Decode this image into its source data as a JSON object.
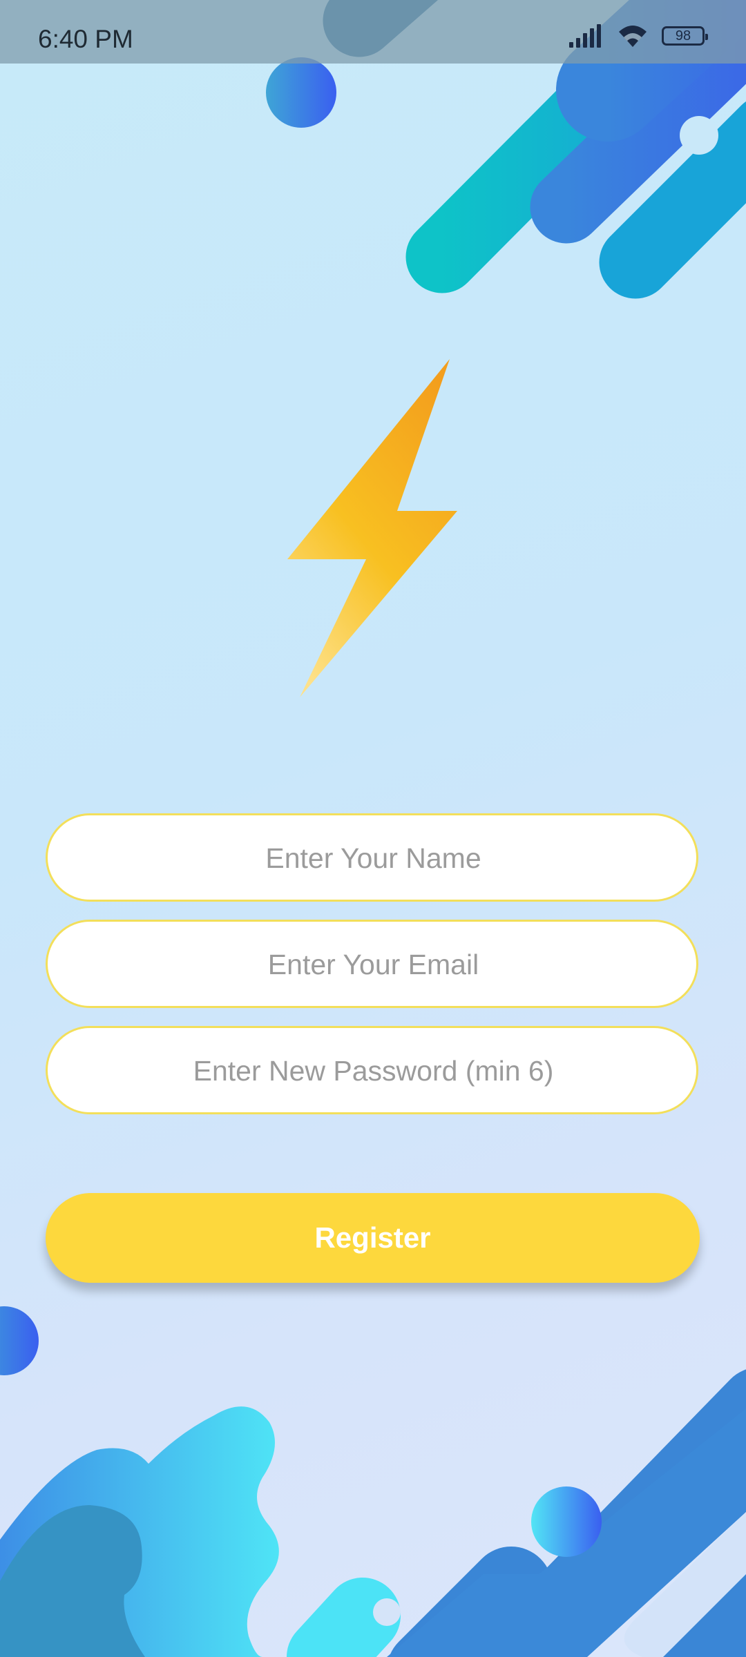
{
  "status_bar": {
    "time": "6:40 PM",
    "battery_level": "98",
    "icons": [
      "signal-icon",
      "wifi-icon",
      "battery-icon"
    ]
  },
  "logo": {
    "icon": "lightning-bolt-icon"
  },
  "form": {
    "name_placeholder": "Enter Your Name",
    "email_placeholder": "Enter Your Email",
    "password_placeholder": "Enter New Password (min 6)",
    "register_label": "Register"
  },
  "colors": {
    "button": "#fdd83d",
    "field_border": "#f3df5a",
    "bolt": "#f6b51c",
    "accent_blue": "#3a6ee6",
    "accent_teal": "#12bccb"
  }
}
